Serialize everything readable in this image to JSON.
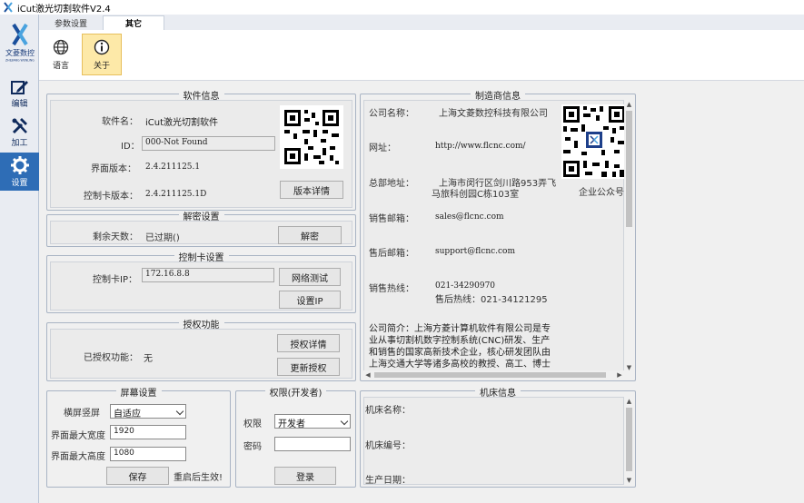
{
  "window": {
    "title": "iCut激光切割软件V2.4"
  },
  "logo": {
    "name": "文菱数控",
    "sub": "ZHEJIANG WENLING"
  },
  "sidebar": {
    "items": [
      {
        "label": "编辑",
        "icon": "edit-icon"
      },
      {
        "label": "加工",
        "icon": "tools-icon"
      },
      {
        "label": "设置",
        "icon": "gear-icon"
      }
    ]
  },
  "tabs": [
    {
      "label": "参数设置"
    },
    {
      "label": "其它"
    }
  ],
  "ribbon": {
    "language_label": "语言",
    "about_label": "关于"
  },
  "software_info": {
    "title": "软件信息",
    "name_label": "软件名：",
    "name_value": "iCut激光切割软件",
    "id_label": "ID：",
    "id_value": "000-Not Found",
    "version_label": "界面版本：",
    "version_value": "2.4.211125.1",
    "card_version_label": "控制卡版本：",
    "card_version_value": "2.4.211125.1D",
    "version_detail_button": "版本详情"
  },
  "decrypt": {
    "title": "解密设置",
    "days_label": "剩余天数：",
    "days_value": "已过期()",
    "decrypt_button": "解密"
  },
  "card_settings": {
    "title": "控制卡设置",
    "ip_label": "控制卡IP：",
    "ip_value": "172.16.8.8",
    "network_test_button": "网络测试",
    "set_ip_button": "设置IP"
  },
  "license": {
    "title": "授权功能",
    "licensed_label": "已授权功能：",
    "licensed_value": "无",
    "detail_button": "授权详情",
    "update_button": "更新授权"
  },
  "manufacturer": {
    "title": "制造商信息",
    "company_label": "公司名称：",
    "company_value": "上海文菱数控科技有限公司",
    "website_label": "网址：",
    "website_value": "http://www.flcnc.com/",
    "address_label": "总部地址：",
    "address_line1": "上海市闵行区剑川路953弄飞",
    "address_line2": "马旅科创园C栋103室",
    "sales_email_label": "销售邮箱：",
    "sales_email_value": "sales@flcnc.com",
    "support_email_label": "售后邮箱：",
    "support_email_value": "support@flcnc.com",
    "hotline_label": "销售热线：",
    "hotline_value": "021-34290970",
    "support_hotline": "售后热线：021-34121295",
    "intro": "公司简介：上海方菱计算机软件有限公司是专业从事切割机数字控制系统(CNC)研发、生产和销售的国家高新技术企业，核心研发团队由上海交通大学等诸多高校的教授、高工、博士和硕士组成，公司依托与上海交大的地利优势，与交大进行产学研合作，本公司的产品研发与",
    "wechat_label": "企业公众号"
  },
  "screen_settings": {
    "title": "屏幕设置",
    "orientation_label": "横屏竖屏",
    "orientation_value": "自适应",
    "max_width_label": "界面最大宽度",
    "max_width_value": "1920",
    "max_height_label": "界面最大高度",
    "max_height_value": "1080",
    "save_button": "保存",
    "restart_note": "重启后生效!"
  },
  "permission": {
    "title": "权限(开发者)",
    "role_label": "权限",
    "role_value": "开发者",
    "password_label": "密码",
    "password_value": "",
    "login_button": "登录"
  },
  "machine_info": {
    "title": "机床信息",
    "name_label": "机床名称：",
    "number_label": "机床编号：",
    "date_label": "生产日期："
  }
}
